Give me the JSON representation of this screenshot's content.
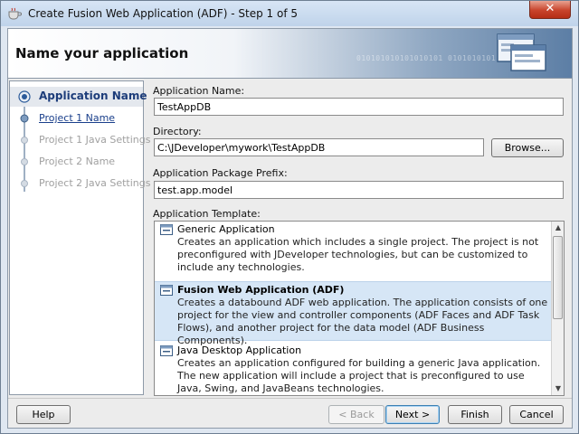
{
  "window": {
    "title": "Create Fusion Web Application (ADF) - Step 1 of 5",
    "close_label": "✕"
  },
  "header": {
    "title": "Name your application",
    "binary_text": "010101010101010101 0101010101"
  },
  "steps": [
    {
      "label": "Application Name",
      "state": "active"
    },
    {
      "label": "Project 1 Name",
      "state": "link"
    },
    {
      "label": "Project 1 Java Settings",
      "state": "disabled"
    },
    {
      "label": "Project 2 Name",
      "state": "disabled"
    },
    {
      "label": "Project 2 Java Settings",
      "state": "disabled"
    }
  ],
  "form": {
    "app_name_label": "Application Name:",
    "app_name_value": "TestAppDB",
    "directory_label": "Directory:",
    "directory_value": "C:\\JDeveloper\\mywork\\TestAppDB",
    "browse_label": "Browse...",
    "package_label": "Application Package Prefix:",
    "package_value": "test.app.model",
    "template_label": "Application Template:"
  },
  "templates": [
    {
      "name": "Generic Application",
      "desc": "Creates an application which includes a single project. The project is not preconfigured with JDeveloper technologies, but can be customized to include any technologies.",
      "selected": false
    },
    {
      "name": "Fusion Web Application (ADF)",
      "desc": "Creates a databound ADF web application. The application consists of one project for the view and controller components (ADF Faces and ADF Task Flows), and another project for the data model (ADF Business Components).",
      "selected": true
    },
    {
      "name": "Java Desktop Application",
      "desc": "Creates an application configured for building a generic Java application. The new application will include a project that is preconfigured to use Java, Swing, and JavaBeans technologies.",
      "selected": false
    }
  ],
  "buttons": {
    "help": "Help",
    "back": "< Back",
    "next": "Next >",
    "finish": "Finish",
    "cancel": "Cancel"
  },
  "colors": {
    "accent": "#1d3d7a",
    "selection": "#d6e6f6",
    "close": "#c8432b"
  }
}
